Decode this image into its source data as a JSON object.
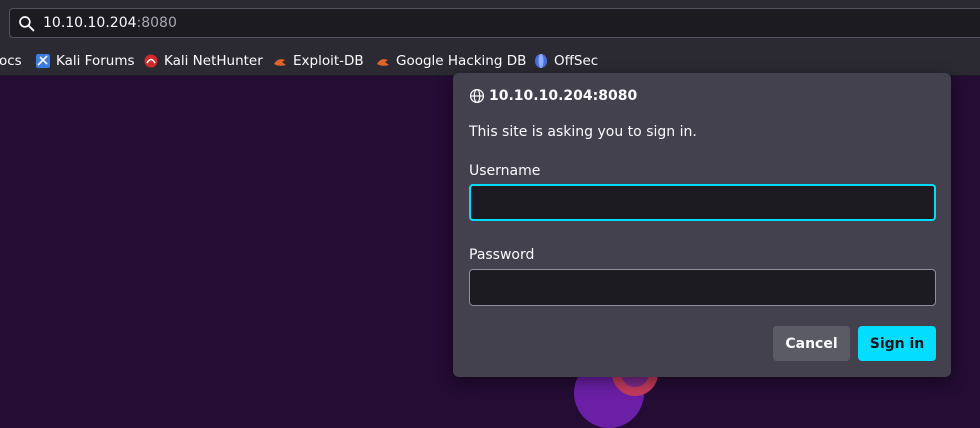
{
  "urlbar": {
    "host": "10.10.10.204",
    "port": ":8080",
    "icon": "search-icon"
  },
  "bookmarks": [
    {
      "label": "ocs",
      "icon": ""
    },
    {
      "label": "Kali Forums",
      "icon": "kali-forums-icon"
    },
    {
      "label": "Kali NetHunter",
      "icon": "kali-nethunter-icon"
    },
    {
      "label": "Exploit-DB",
      "icon": "exploit-db-icon"
    },
    {
      "label": "Google Hacking DB",
      "icon": "exploit-db-icon"
    },
    {
      "label": "OffSec",
      "icon": "offsec-icon"
    }
  ],
  "dialog": {
    "site": "10.10.10.204:8080",
    "message": "This site is asking you to sign in.",
    "username_label": "Username",
    "username_value": "",
    "password_label": "Password",
    "password_value": "",
    "cancel_label": "Cancel",
    "signin_label": "Sign in"
  },
  "colors": {
    "page_background": "#240c34",
    "accent": "#00ddff",
    "dialog_background": "#42414d"
  }
}
